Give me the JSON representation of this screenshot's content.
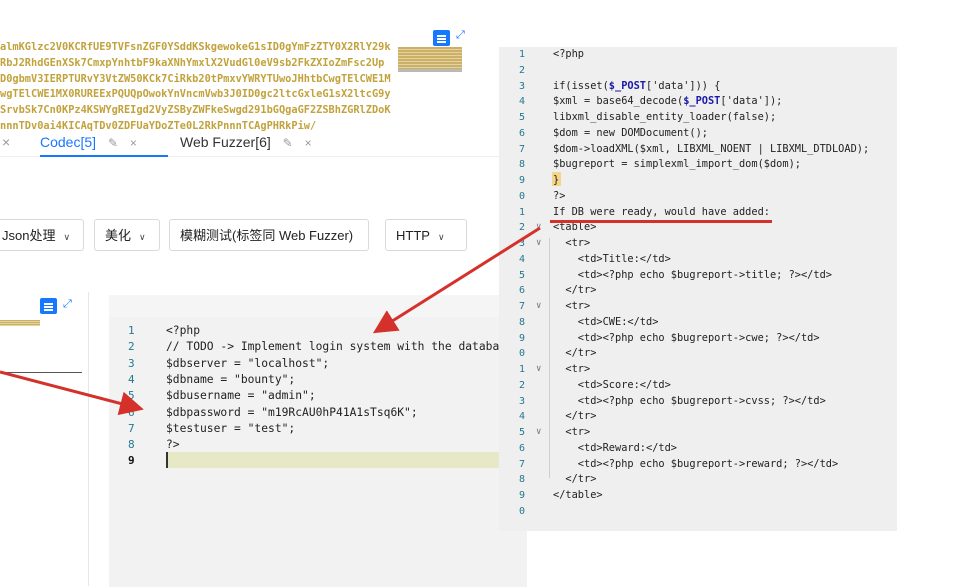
{
  "encoded_panel": {
    "lines": [
      "almKGlzc2V0KCRfUE9TVFsnZGF0YSddKSkgewokeG1sID0gYmFzZTY0X2RlY29k",
      "RbJ2RhdGEnXSk7CmxpYnhtbF9kaXNhYmxlX2VudGl0eV9sb2FkZXIoZmFsc2Up",
      "D0gbmV3IERPTURvY3VtZW50KCk7CiRkb20tPmxvYWRYTUwoJHhtbCwgTElCWE1M",
      "wgTElCWE1MX0RUREExPQUQpOwokYnVncmVwb3J0ID0gc2ltcGxleG1sX2ltcG9y",
      "SrvbSk7Cn0KPz4KSWYgREIgd2VyZSByZWFkeSwgd291bGQgaGF2ZSBhZGRlZDoK",
      "nnnTDv0ai4KICAqTDv0ZDFUaYDoZTe0L2RkPnnnTCAgPHRkPiw/"
    ]
  },
  "tabs": {
    "prev_close": "×",
    "codec_label": "Codec[5]",
    "fuzzer_label": "Web Fuzzer[6]",
    "edit_icon": "✎",
    "close_icon": "×"
  },
  "toolbar": {
    "json_label": "Json处理",
    "beautify_label": "美化",
    "fuzz_label": "模糊测试(标签同 Web Fuzzer)",
    "http_label": "HTTP"
  },
  "bottom_editor": {
    "lines": [
      {
        "n": "1",
        "code": "<?php"
      },
      {
        "n": "2",
        "code": "// TODO -> Implement login system with the database."
      },
      {
        "n": "3",
        "code": "$dbserver = \"localhost\";"
      },
      {
        "n": "4",
        "code": "$dbname = \"bounty\";"
      },
      {
        "n": "5",
        "code": "$dbusername = \"admin\";"
      },
      {
        "n": "6",
        "code": "$dbpassword = \"m19RcAU0hP41A1sTsq6K\";"
      },
      {
        "n": "7",
        "code": "$testuser = \"test\";"
      },
      {
        "n": "8",
        "code": "?>"
      },
      {
        "n": "9",
        "code": ""
      }
    ]
  },
  "right_editor": {
    "lines": [
      {
        "n": "1",
        "fold": "",
        "code": "<?php"
      },
      {
        "n": "2",
        "fold": "",
        "code": ""
      },
      {
        "n": "3",
        "fold": "",
        "code": "if(isset($_POST['data'])) {"
      },
      {
        "n": "4",
        "fold": "",
        "code": "$xml = base64_decode($_POST['data']);"
      },
      {
        "n": "5",
        "fold": "",
        "code": "libxml_disable_entity_loader(false);"
      },
      {
        "n": "6",
        "fold": "",
        "code": "$dom = new DOMDocument();"
      },
      {
        "n": "7",
        "fold": "",
        "code": "$dom->loadXML($xml, LIBXML_NOENT | LIBXML_DTDLOAD);"
      },
      {
        "n": "8",
        "fold": "",
        "code": "$bugreport = simplexml_import_dom($dom);"
      },
      {
        "n": "9",
        "fold": "",
        "code": "}"
      },
      {
        "n": "0",
        "fold": "",
        "code": "?>"
      },
      {
        "n": "1",
        "fold": "",
        "code": "If DB were ready, would have added:"
      },
      {
        "n": "2",
        "fold": "∨",
        "code": "<table>"
      },
      {
        "n": "3",
        "fold": "∨",
        "code": "  <tr>"
      },
      {
        "n": "4",
        "fold": "",
        "code": "    <td>Title:</td>"
      },
      {
        "n": "5",
        "fold": "",
        "code": "    <td><?php echo $bugreport->title; ?></td>"
      },
      {
        "n": "6",
        "fold": "",
        "code": "  </tr>"
      },
      {
        "n": "7",
        "fold": "∨",
        "code": "  <tr>"
      },
      {
        "n": "8",
        "fold": "",
        "code": "    <td>CWE:</td>"
      },
      {
        "n": "9",
        "fold": "",
        "code": "    <td><?php echo $bugreport->cwe; ?></td>"
      },
      {
        "n": "0",
        "fold": "",
        "code": "  </tr>"
      },
      {
        "n": "1",
        "fold": "∨",
        "code": "  <tr>"
      },
      {
        "n": "2",
        "fold": "",
        "code": "    <td>Score:</td>"
      },
      {
        "n": "3",
        "fold": "",
        "code": "    <td><?php echo $bugreport->cvss; ?></td>"
      },
      {
        "n": "4",
        "fold": "",
        "code": "  </tr>"
      },
      {
        "n": "5",
        "fold": "∨",
        "code": "  <tr>"
      },
      {
        "n": "6",
        "fold": "",
        "code": "    <td>Reward:</td>"
      },
      {
        "n": "7",
        "fold": "",
        "code": "    <td><?php echo $bugreport->reward; ?></td>"
      },
      {
        "n": "8",
        "fold": "",
        "code": "  </tr>"
      },
      {
        "n": "9",
        "fold": "",
        "code": "</table>"
      },
      {
        "n": "0",
        "fold": "",
        "code": ""
      }
    ]
  },
  "colors": {
    "accent": "#1677ff",
    "annotation_red": "#d4312a",
    "encoded_text": "#c2a23c",
    "line_number": "#237893"
  }
}
